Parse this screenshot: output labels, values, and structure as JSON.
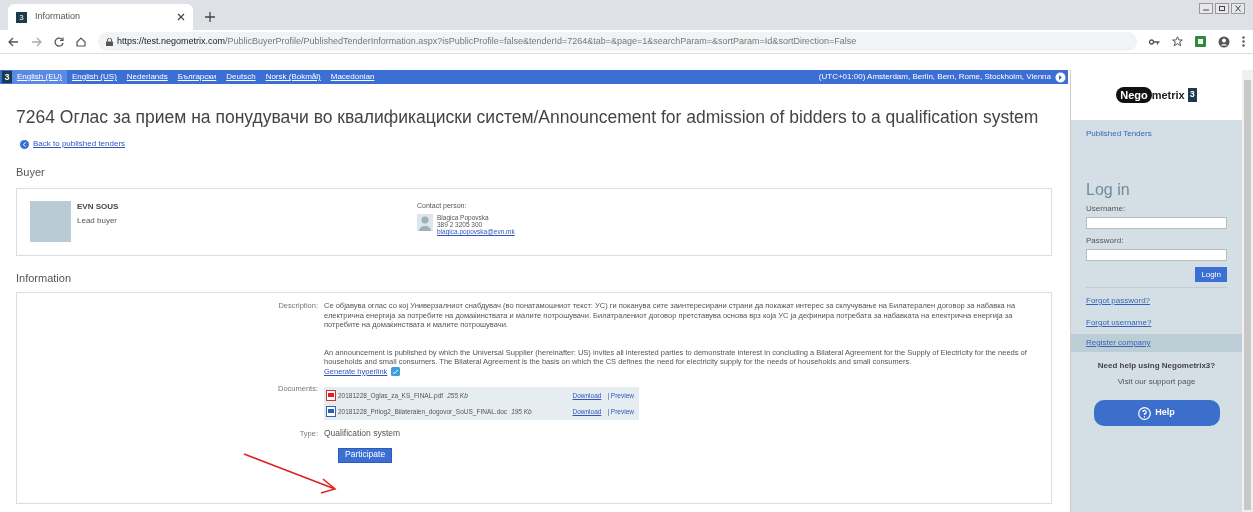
{
  "browser": {
    "tab_icon": "3",
    "tab_title": "Information",
    "url_host": "https://test.negometrix.com",
    "url_path": "/PublicBuyerProfile/PublishedTenderInformation.aspx?isPublicProfile=false&tenderId=7264&tab=&page=1&searchParam=&sortParam=Id&sortDirection=False"
  },
  "language_bar": {
    "logo": "3",
    "languages": [
      {
        "label": "English (EU)",
        "selected": true
      },
      {
        "label": "English (US)",
        "selected": false
      },
      {
        "label": "Nederlands",
        "selected": false
      },
      {
        "label": "Български",
        "selected": false
      },
      {
        "label": "Deutsch",
        "selected": false
      },
      {
        "label": "Norsk (Bokmål)",
        "selected": false
      },
      {
        "label": "Macedonian",
        "selected": false
      }
    ],
    "timezone": "(UTC+01:00) Amsterdam, Berlin, Bern, Rome, Stockholm, Vienna"
  },
  "title": "7264 Оглас за прием на понудувачи во квалификациски систем/Announcement for admission of bidders to a qualification system",
  "back_link": "Back to published tenders",
  "buyer": {
    "heading": "Buyer",
    "name": "EVN SOUS",
    "role": "Lead buyer",
    "contact_label": "Contact person:",
    "contact_name": "Blagica Popovska",
    "contact_phone": "389 2 3205 300",
    "contact_email": "blagica.popovska@evn.mk"
  },
  "information": {
    "heading": "Information",
    "description_label": "Description:",
    "description_mk": "Се објавува оглас со кој Универзалниот снабдувач (во понатамошниот текст: УС) ги поканува сите заинтересирани страни да покажат интерес за склучување на Билатерален договор за набавка на електрична енергија за потребите на домаќинствата и малите потрошувачи. Билатралениот договор претставува основа врз која УС ја дефинира потребата за набавката на електрична енергија за потребите на домаќинствата и малите потрошувачи.",
    "description_en": "An announcement is published by which the Universal Supplier (hereinafter: US) invites all interested parties to demonstrate interest in concluding a Bilateral Agreement for the Supply of Electricity for the needs of households and small consumers. The Bilateral Agreement is the basis on which the CS defines the need for electricity supply for the needs of households and small consumers.",
    "generate_link": "Generate hyperlink",
    "documents_label": "Documents:",
    "documents": [
      {
        "kind": "pdf",
        "filename": "20181228_Oglas_za_KS_FINAL.pdf",
        "size": "255 Kb",
        "download": "Download",
        "preview": "| Preview"
      },
      {
        "kind": "doc",
        "filename": "20181228_Prilog2_Bilateralen_dogovor_SoUS_FINAL.doc",
        "size": "195 Kb",
        "download": "Download",
        "preview": "| Preview"
      }
    ],
    "type_label": "Type:",
    "type_value": "Qualification system",
    "participate": "Participate"
  },
  "sidebar": {
    "logo_dark": "Nego",
    "logo_light": "metrix",
    "logo_badge": "3",
    "published_tenders": "Published Tenders",
    "login_heading": "Log in",
    "username_label": "Username:",
    "password_label": "Password:",
    "login_button": "Login",
    "forgot_password": "Forgot password?",
    "forgot_username": "Forgot username?",
    "register": "Register company",
    "help_title": "Need help using Negometrix3?",
    "help_subtitle": "Visit our support page",
    "help_button": "Help"
  }
}
